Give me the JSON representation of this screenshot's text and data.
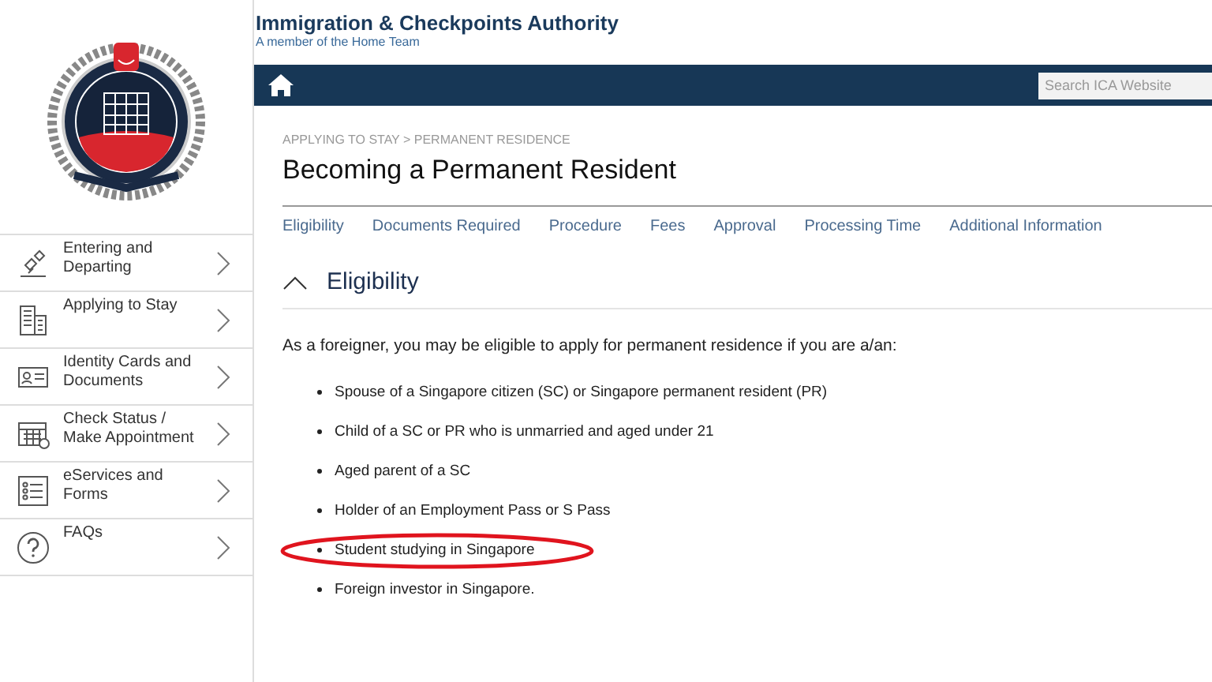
{
  "header": {
    "title": "Immigration & Checkpoints Authority",
    "subtitle": "A member of the Home Team"
  },
  "search": {
    "placeholder": "Search ICA Website"
  },
  "sidebar": {
    "items": [
      {
        "label": "Entering and Departing",
        "kind": "travel"
      },
      {
        "label": "Applying to Stay",
        "kind": "building"
      },
      {
        "label": "Identity Cards and Documents",
        "kind": "card"
      },
      {
        "label": "Check Status / Make Appointment",
        "kind": "calendar"
      },
      {
        "label": "eServices and Forms",
        "kind": "list"
      },
      {
        "label": "FAQs",
        "kind": "faq"
      }
    ]
  },
  "breadcrumb": "APPLYING TO STAY > PERMANENT RESIDENCE",
  "page_title": "Becoming a Permanent Resident",
  "tabs": [
    "Eligibility",
    "Documents Required",
    "Procedure",
    "Fees",
    "Approval",
    "Processing Time",
    "Additional Information"
  ],
  "section": {
    "title": "Eligibility",
    "expanded": true,
    "intro": "As a foreigner, you may be eligible to apply for permanent residence if you are a/an:",
    "items": [
      {
        "text": "Spouse of a Singapore citizen (SC) or Singapore permanent resident (PR)",
        "circled": false
      },
      {
        "text": "Child of a SC or PR who is unmarried and aged under 21",
        "circled": false
      },
      {
        "text": "Aged parent of a SC",
        "circled": false
      },
      {
        "text": "Holder of an Employment Pass or S Pass",
        "circled": false
      },
      {
        "text": "Student studying in Singapore",
        "circled": true
      },
      {
        "text": "Foreign investor in Singapore.",
        "circled": false
      }
    ]
  }
}
